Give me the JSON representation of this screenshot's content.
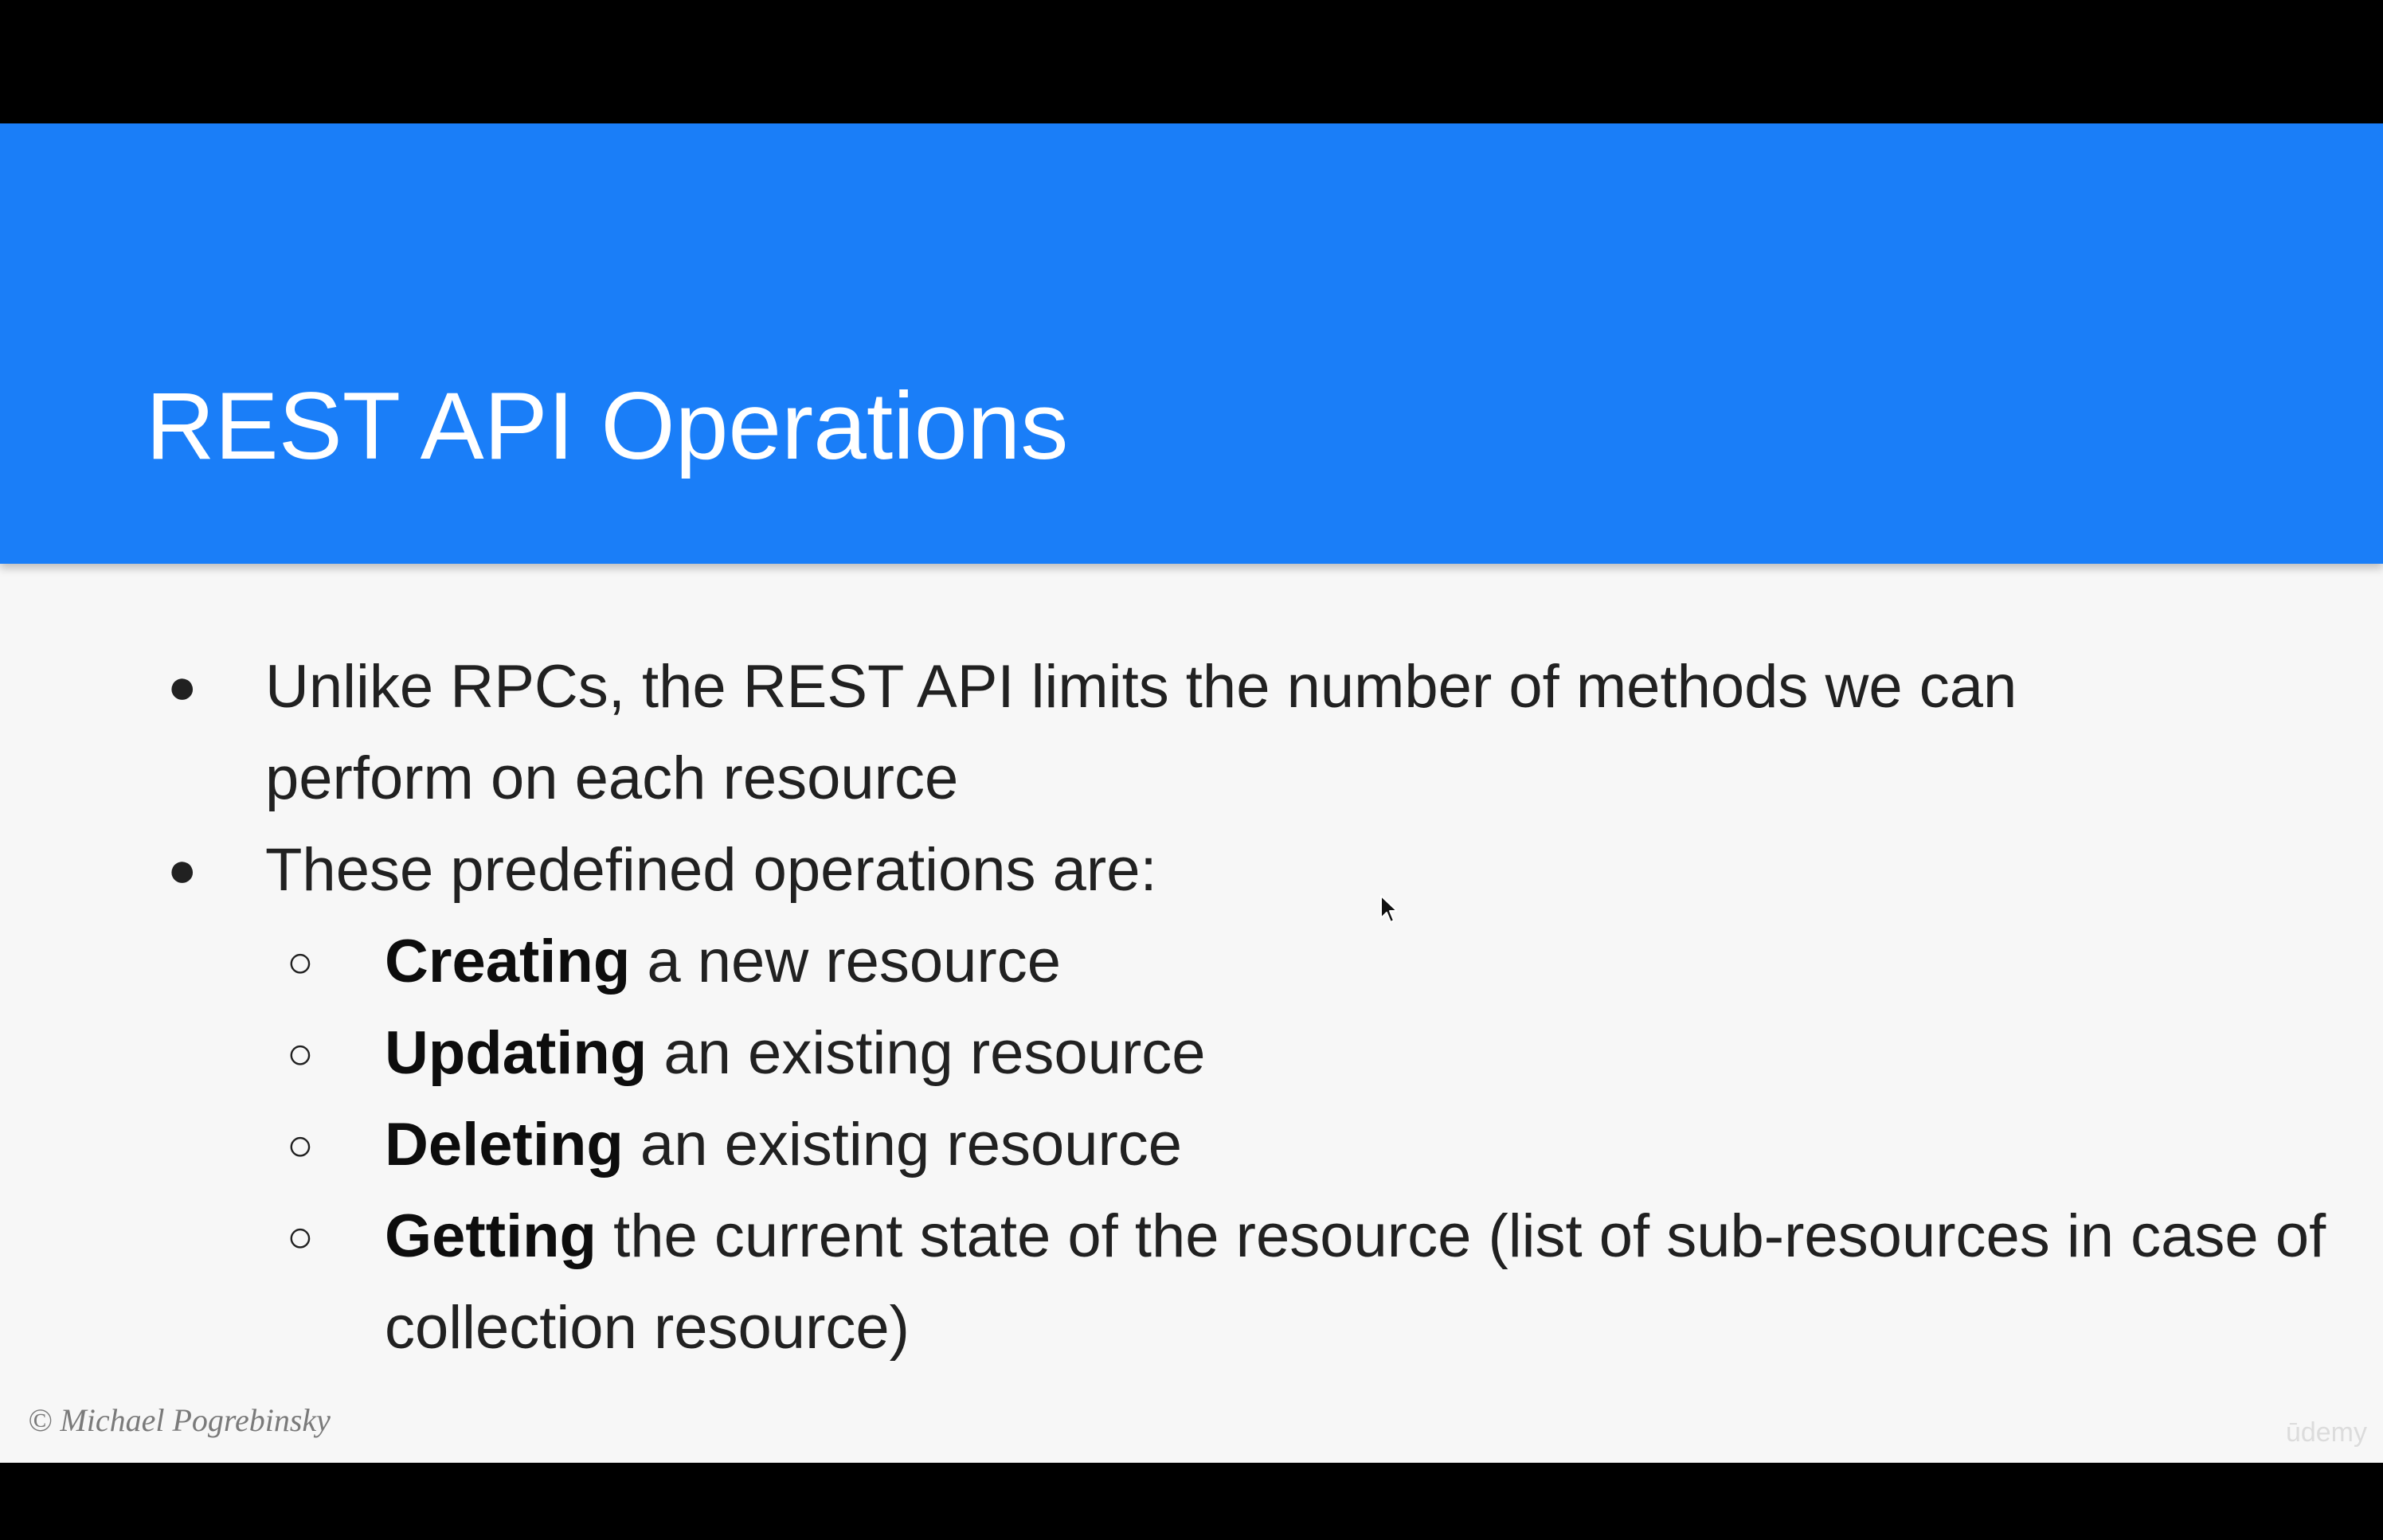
{
  "slide": {
    "title": "REST API Operations",
    "bullets": [
      {
        "marker": "●",
        "text": "Unlike RPCs, the REST API limits the number of methods we can perform on each resource"
      },
      {
        "marker": "●",
        "text": "These predefined operations are:",
        "sub_items": [
          {
            "marker": "○",
            "bold": "Creating",
            "rest": " a new resource"
          },
          {
            "marker": "○",
            "bold": "Updating",
            "rest": " an existing resource"
          },
          {
            "marker": "○",
            "bold": "Deleting",
            "rest": " an existing resource"
          },
          {
            "marker": "○",
            "bold": "Getting",
            "rest": " the current state of the resource (list of sub-resources in case of collection resource)"
          }
        ]
      }
    ],
    "copyright": "© Michael Pogrebinsky",
    "watermark": "ūdemy"
  },
  "colors": {
    "header_band": "#1a7ef8",
    "slide_background": "#f7f7f7",
    "letterbox": "#000000",
    "body_text": "#212121",
    "title_text": "#ffffff"
  },
  "icons": {
    "cursor": "mouse-pointer-icon"
  }
}
